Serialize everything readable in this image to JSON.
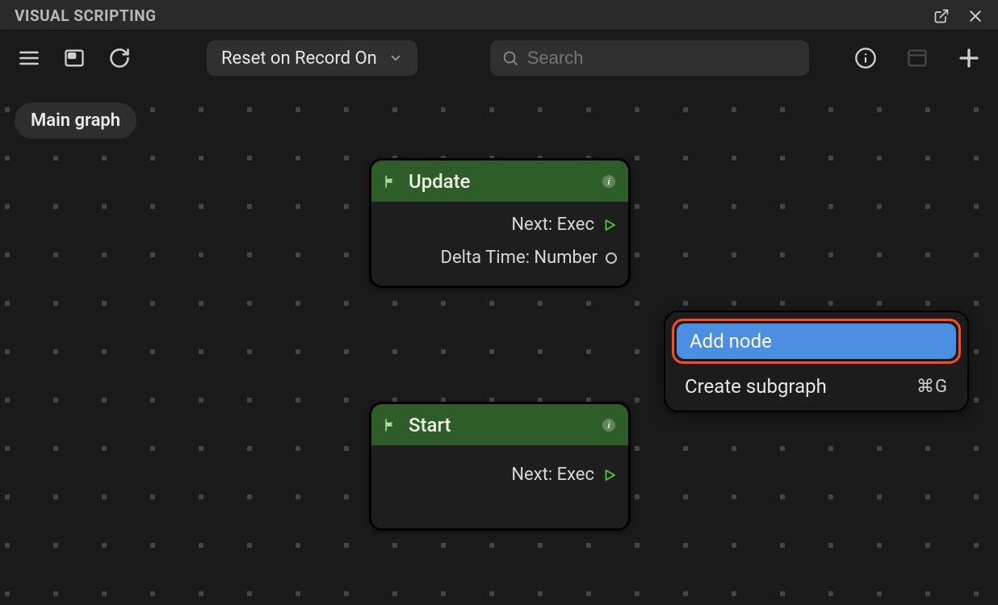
{
  "panel_title": "VISUAL SCRIPTING",
  "toolbar": {
    "dropdown_label": "Reset on Record On",
    "search_placeholder": "Search"
  },
  "breadcrumb": "Main graph",
  "nodes": {
    "update": {
      "title": "Update",
      "ports": {
        "next": "Next: Exec",
        "delta": "Delta Time: Number"
      }
    },
    "start": {
      "title": "Start",
      "ports": {
        "next": "Next: Exec"
      }
    }
  },
  "context_menu": {
    "add_node": "Add node",
    "create_subgraph": "Create subgraph",
    "create_subgraph_shortcut": "⌘G"
  }
}
